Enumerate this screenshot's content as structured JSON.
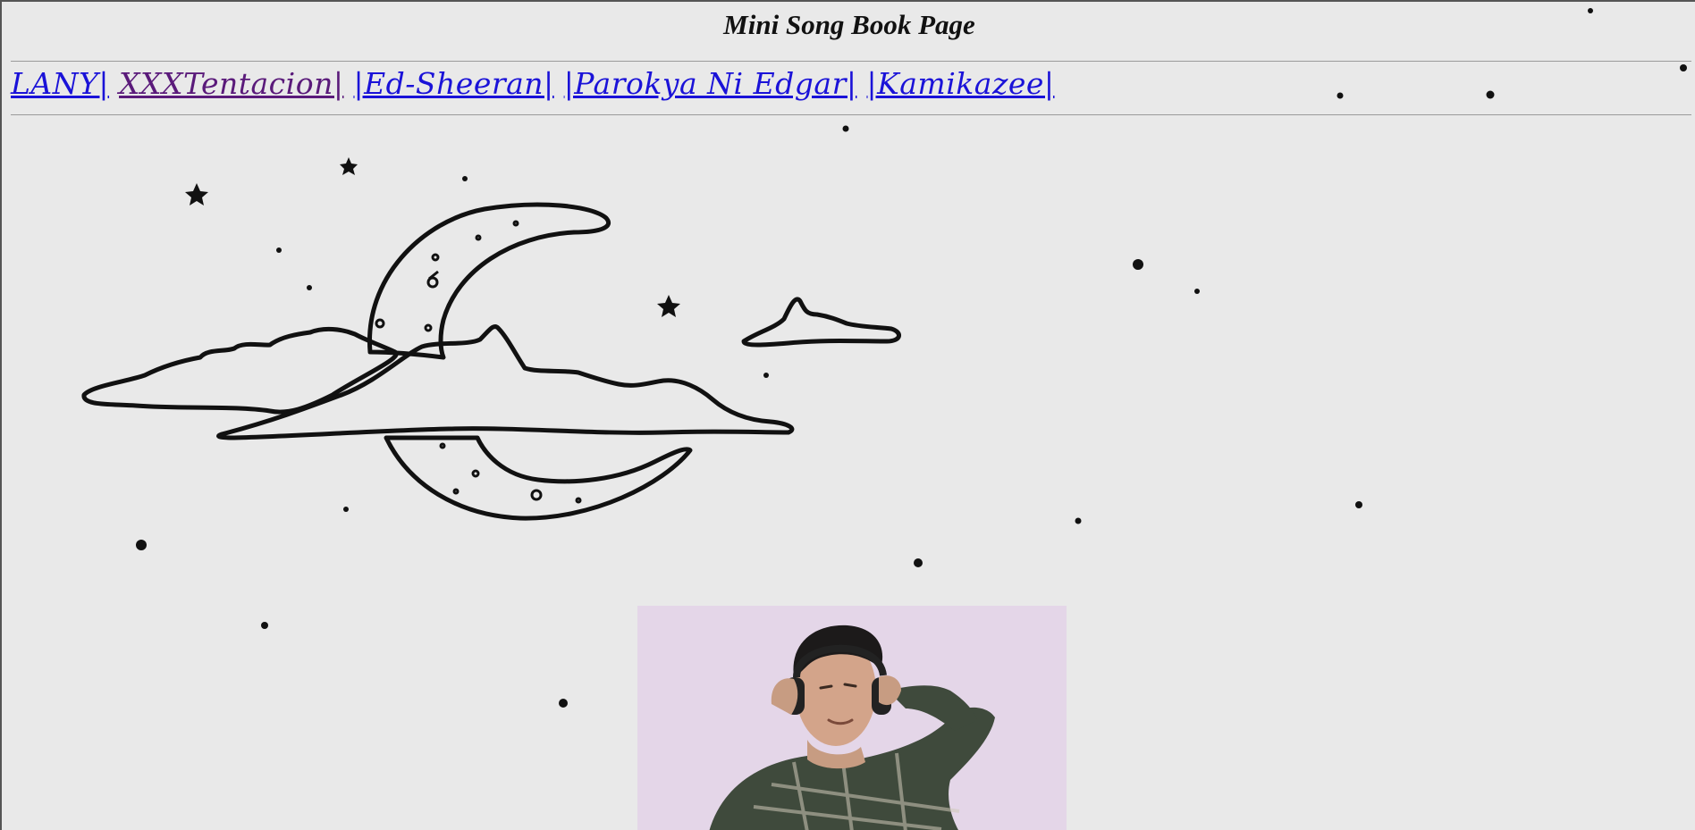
{
  "page": {
    "title": "Mini Song Book Page"
  },
  "nav": {
    "links": [
      {
        "label": "LANY|",
        "state": "unvisited"
      },
      {
        "label": "XXXTentacion|",
        "state": "visited"
      },
      {
        "label": "|Ed-Sheeran|",
        "state": "unvisited"
      },
      {
        "label": "|Parokya Ni Edgar|",
        "state": "unvisited"
      },
      {
        "label": "|Kamikazee|",
        "state": "unvisited"
      }
    ]
  },
  "colors": {
    "background": "#e9e9e9",
    "link": "#1a12d8",
    "visited_link": "#5a1a7a",
    "photo_background": "#e4d6e8",
    "shirt": "#3f4a3c"
  },
  "images": {
    "background_art": "moon-and-clouds-line-drawing",
    "photo": "man-with-headphones"
  }
}
